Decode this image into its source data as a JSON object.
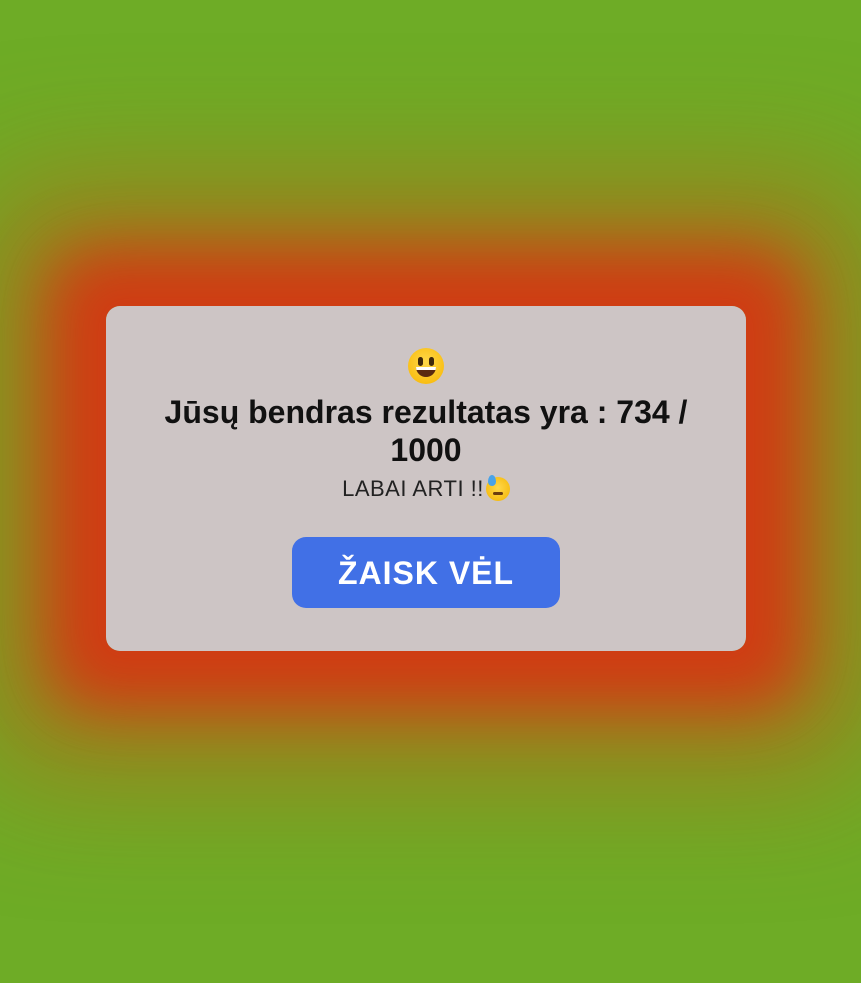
{
  "result": {
    "emoji_icon": "grinning-face",
    "score_text": "Jūsų bendras rezultatas yra : 734 / 1000",
    "score": 734,
    "max_score": 1000,
    "verdict_text": "LABAI ARTI !!",
    "verdict_icon": "downcast-sweat-face",
    "play_again_label": "ŽAISK VĖL"
  },
  "colors": {
    "background": "#6eac26",
    "glow": "#d03c14",
    "modal": "#cdc5c5",
    "button": "#4170e6"
  }
}
